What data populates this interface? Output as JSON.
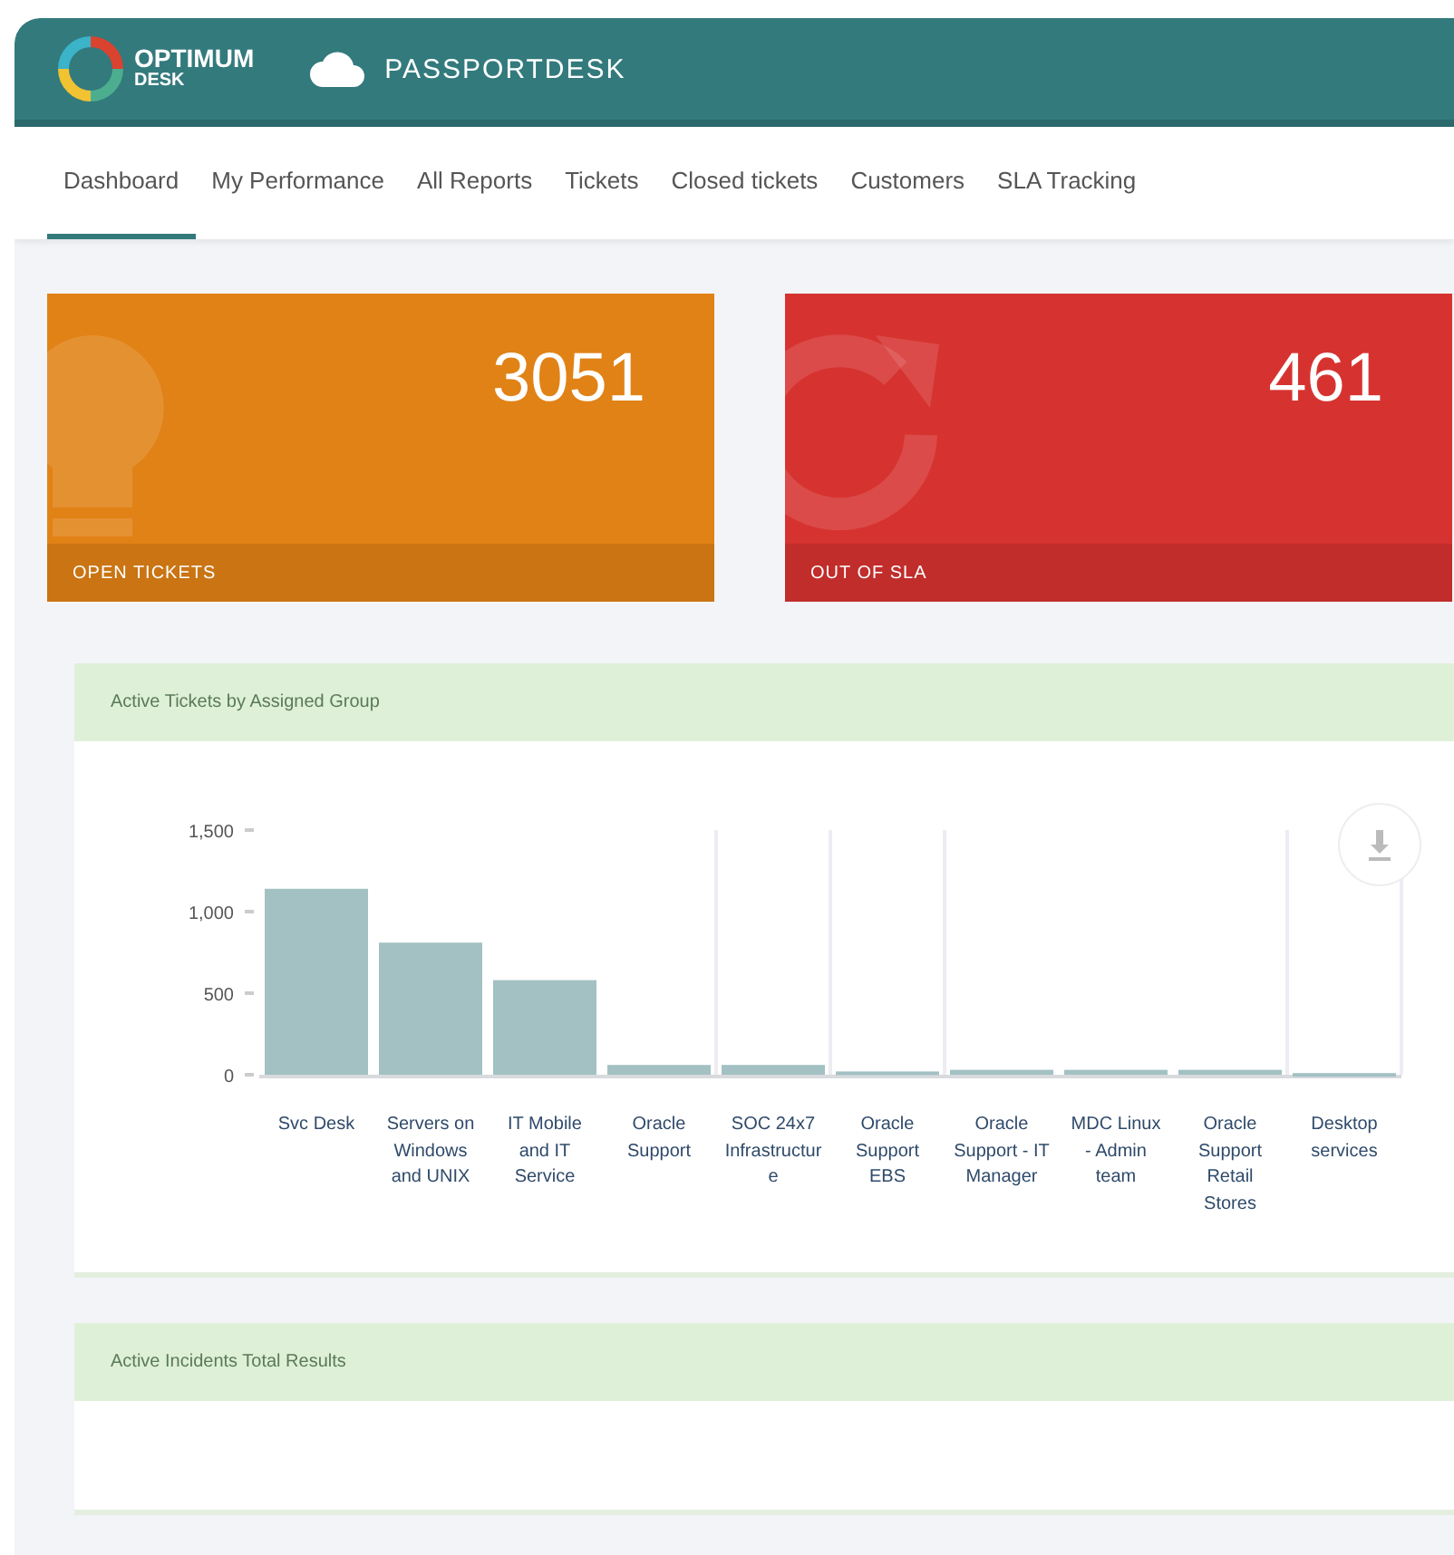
{
  "header": {
    "logo_title": "OPTIMUM",
    "logo_subtitle": "DESK",
    "app_name": "PASSPORTDESK"
  },
  "tabs": [
    {
      "label": "Dashboard",
      "selected": true
    },
    {
      "label": "My Performance",
      "selected": false
    },
    {
      "label": "All Reports",
      "selected": false
    },
    {
      "label": "Tickets",
      "selected": false
    },
    {
      "label": "Closed tickets",
      "selected": false
    },
    {
      "label": "Customers",
      "selected": false
    },
    {
      "label": "SLA Tracking",
      "selected": false
    }
  ],
  "cards": [
    {
      "value": "3051",
      "label": "OPEN TICKETS",
      "color": "#e18216",
      "kind": "bulb"
    },
    {
      "value": "461",
      "label": "OUT OF SLA",
      "color": "#d63330",
      "kind": "refresh"
    }
  ],
  "panels": [
    {
      "title": "Active Tickets by Assigned Group",
      "chart_data": {
        "type": "bar",
        "categories": [
          "Svc Desk",
          "Servers on Windows and UNIX",
          "IT Mobile and IT Service",
          "Oracle Support",
          "SOC 24x7 Infrastructure",
          "Oracle Support EBS",
          "Oracle Support - IT Manager",
          "MDC Linux - Admin team",
          "Oracle Support Retail Stores",
          "Desktop services"
        ],
        "series": [
          {
            "color": "#a3c1c3",
            "values": [
              1140,
              810,
              580,
              60,
              60,
              20,
              30,
              30,
              30,
              10
            ]
          }
        ],
        "ylim": [
          0,
          1500
        ],
        "yticks": [
          {
            "value": 0,
            "label": "0"
          },
          {
            "value": 500,
            "label": "500"
          },
          {
            "value": 1000,
            "label": "1,000"
          },
          {
            "value": 1500,
            "label": "1,500"
          }
        ]
      }
    },
    {
      "title": "Active Incidents Total Results"
    }
  ]
}
